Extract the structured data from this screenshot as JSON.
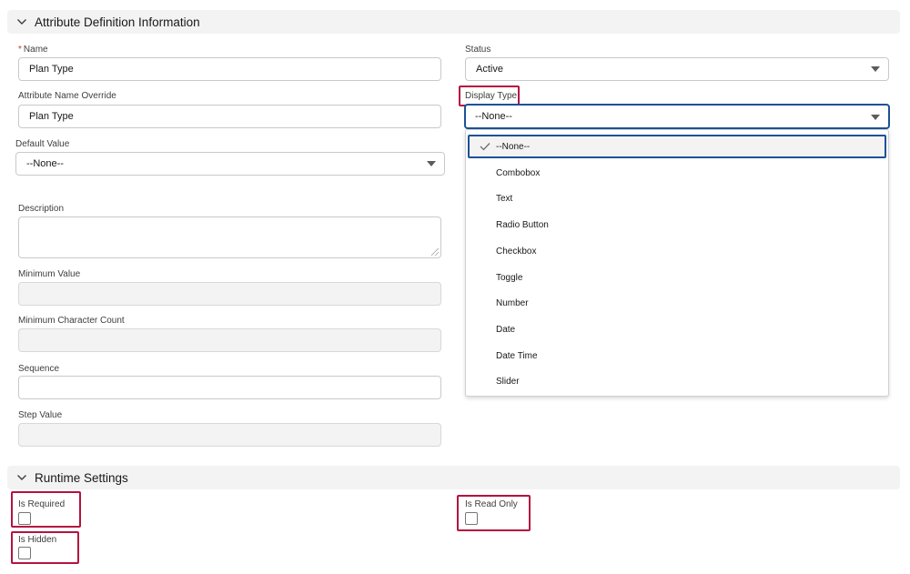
{
  "sections": {
    "attribute_definition": {
      "title": "Attribute Definition Information"
    },
    "runtime": {
      "title": "Runtime Settings"
    }
  },
  "fields": {
    "name": {
      "label": "Name",
      "value": "Plan Type",
      "required_marker": "*"
    },
    "status": {
      "label": "Status",
      "value": "Active"
    },
    "attribute_name_override": {
      "label": "Attribute Name Override",
      "value": "Plan Type"
    },
    "display_type": {
      "label": "Display Type",
      "value": "--None--"
    },
    "default_value": {
      "label": "Default Value",
      "value": "--None--"
    },
    "description": {
      "label": "Description",
      "value": ""
    },
    "minimum_value": {
      "label": "Minimum Value",
      "value": ""
    },
    "minimum_character_count": {
      "label": "Minimum Character Count",
      "value": ""
    },
    "sequence": {
      "label": "Sequence",
      "value": ""
    },
    "step_value": {
      "label": "Step Value",
      "value": ""
    }
  },
  "display_type_options": [
    {
      "label": "--None--",
      "selected": true
    },
    {
      "label": "Combobox",
      "selected": false
    },
    {
      "label": "Text",
      "selected": false
    },
    {
      "label": "Radio Button",
      "selected": false
    },
    {
      "label": "Checkbox",
      "selected": false
    },
    {
      "label": "Toggle",
      "selected": false
    },
    {
      "label": "Number",
      "selected": false
    },
    {
      "label": "Date",
      "selected": false
    },
    {
      "label": "Date Time",
      "selected": false
    },
    {
      "label": "Slider",
      "selected": false
    }
  ],
  "runtime_settings": {
    "is_required": {
      "label": "Is Required",
      "checked": false
    },
    "is_read_only": {
      "label": "Is Read Only",
      "checked": false
    },
    "is_hidden": {
      "label": "Is Hidden",
      "checked": false
    }
  },
  "colors": {
    "focus_border": "#1b5297",
    "highlight_box": "#b5123f",
    "required_marker": "#c23934",
    "section_header_bg": "#f3f3f3"
  }
}
